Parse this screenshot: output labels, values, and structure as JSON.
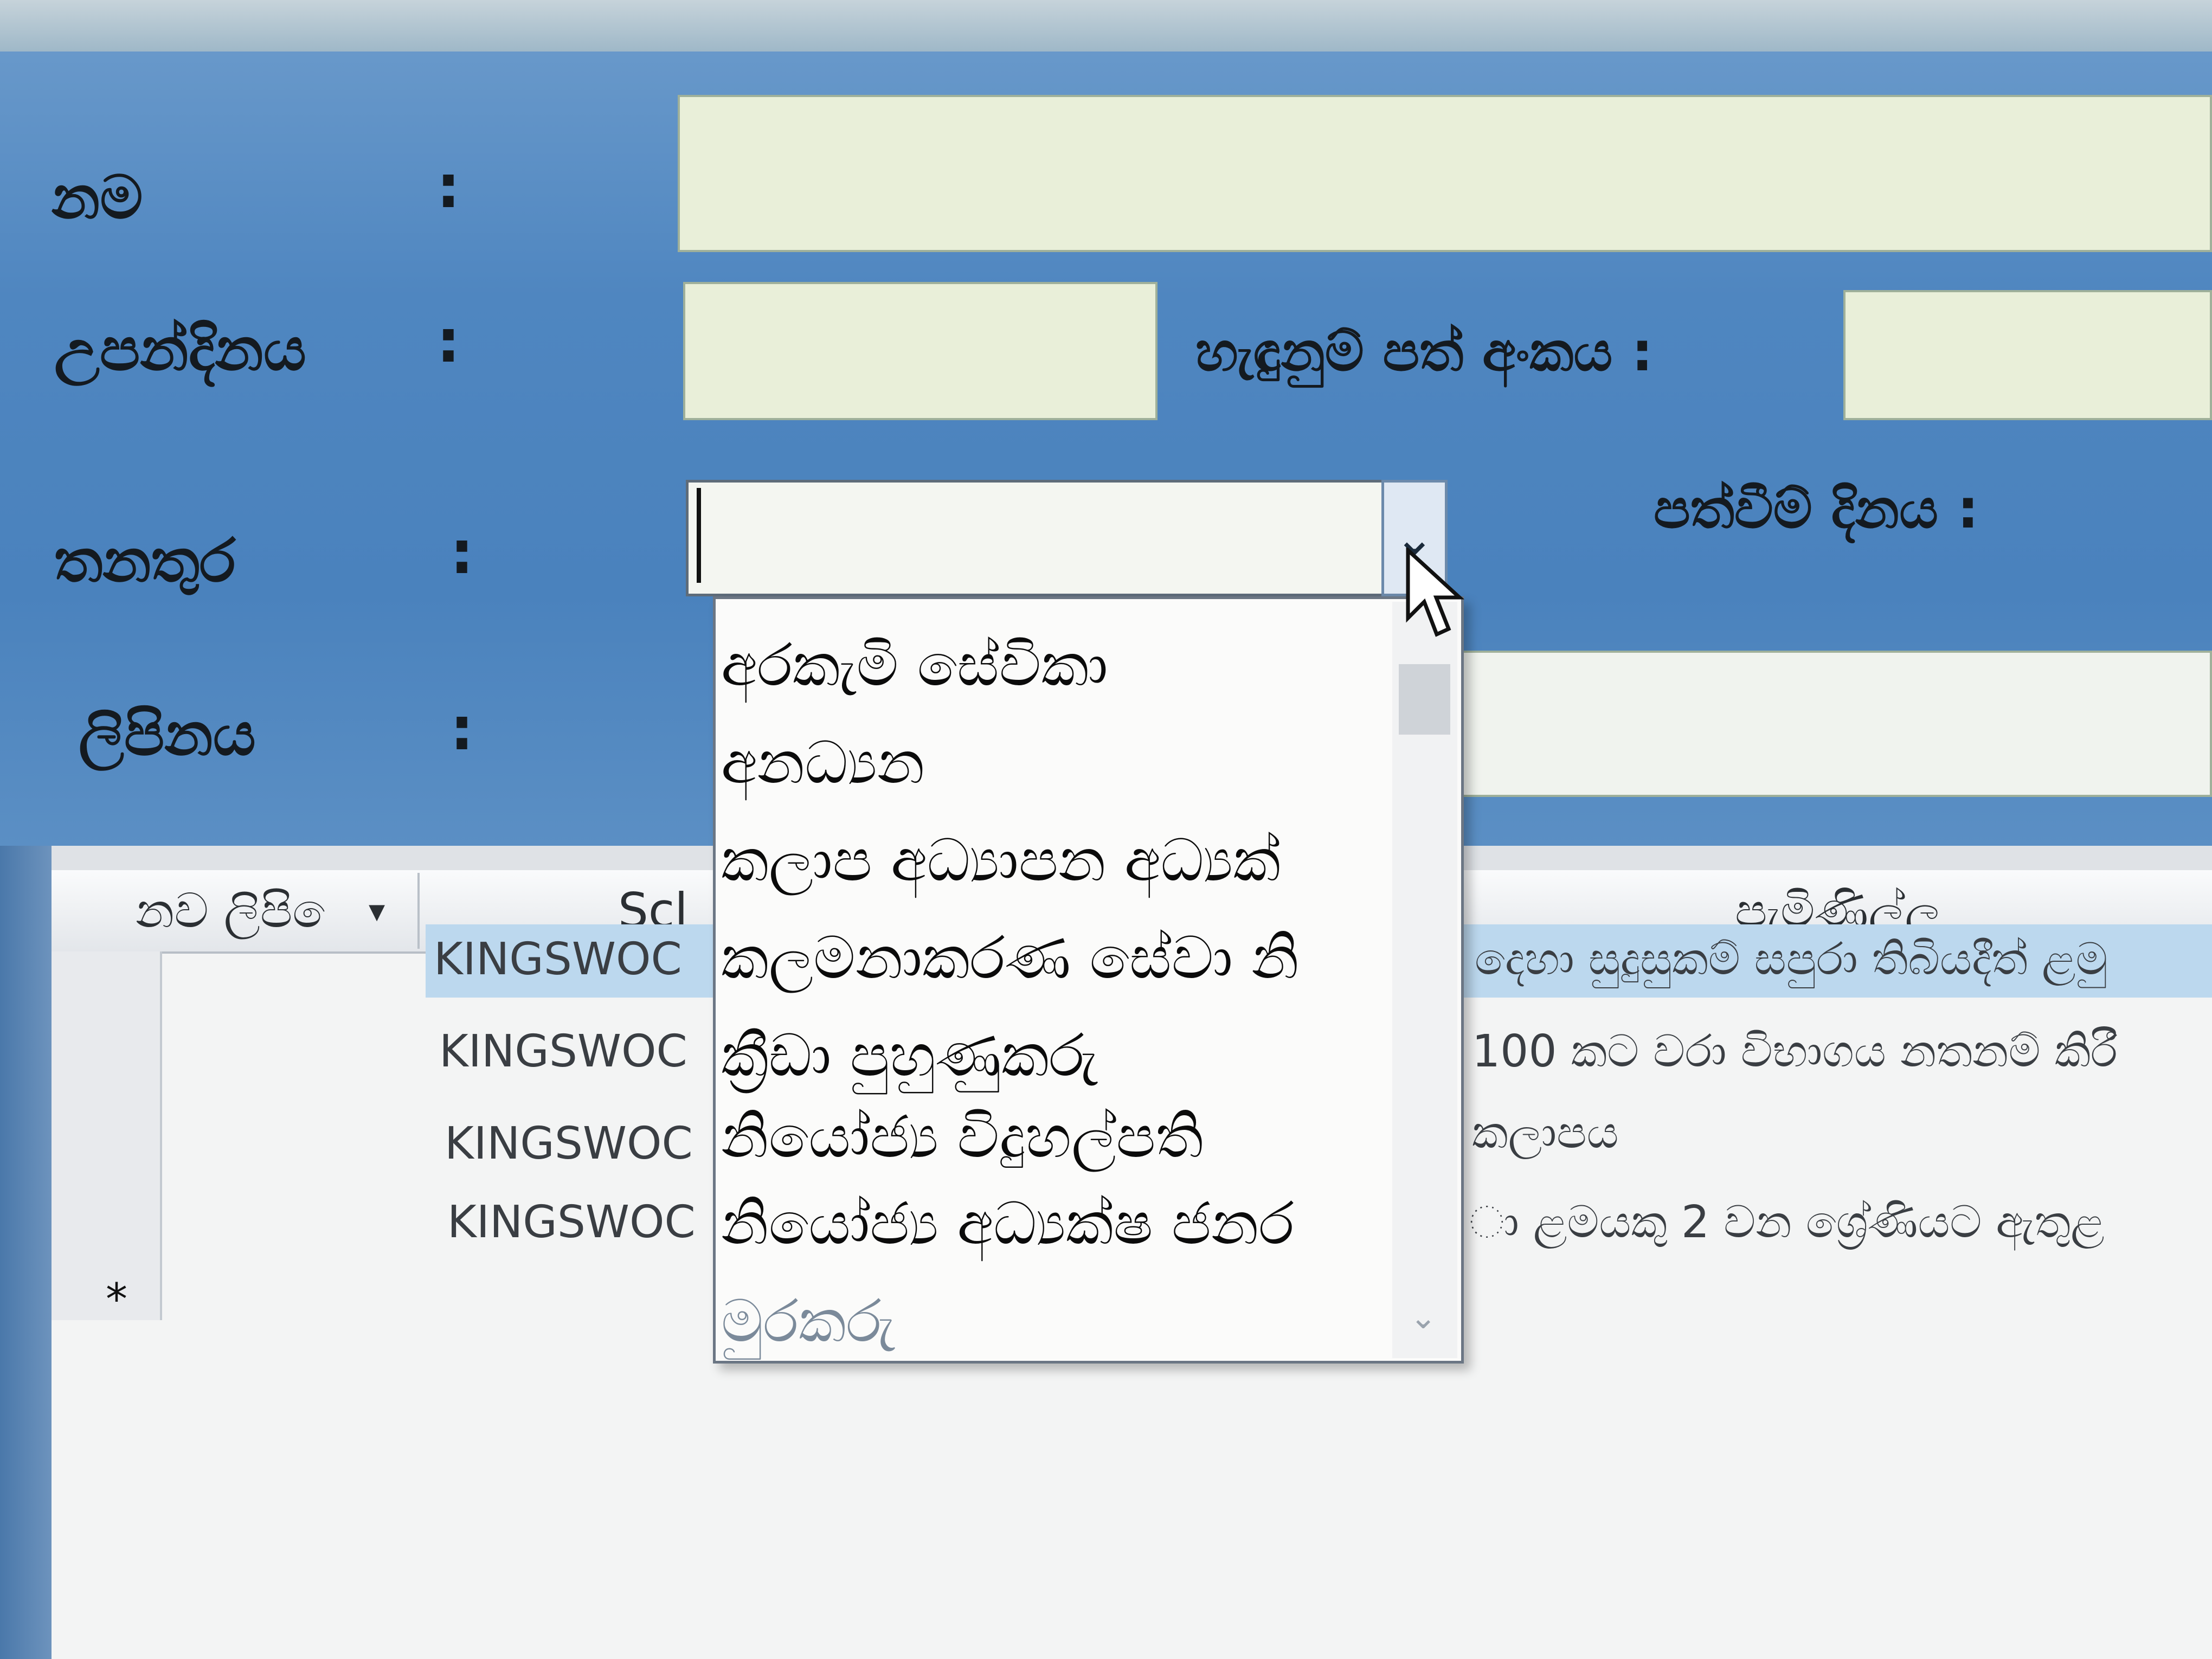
{
  "form": {
    "name_label": "නම",
    "dob_label": "උපන්දිනය",
    "nic_label": "හැඳුනුම් පත් අංකය :",
    "position_label": "තනතුර",
    "appointment_date_label": "පත්වීම් දිනය :",
    "address_label": "ලිපිනය",
    "colon": ":"
  },
  "dropdown": {
    "options": [
      "අරකැමි සේවිකා",
      "අනධ්‍යන",
      "කලාප අධ්‍යාපන අධ්‍යක්",
      "කලමනාකරණ සේවා නි",
      "ක්‍රීඩා පුහුණුකරු",
      "නියෝජ්‍ය විදුහල්පති",
      "නියෝජ්‍ය අධ්‍යක්ෂ ජනර",
      "මුරකරු"
    ]
  },
  "grid": {
    "headers": [
      "නව ලිපි ෙ",
      "Scl",
      "පැමිණිල්ල"
    ],
    "rows": [
      {
        "school": "KINGSWOC",
        "complaint": "දෙහා සුදුසුකම් සපුරා තිබියදීත් ළමු"
      },
      {
        "school": "KINGSWOC",
        "complaint": "100 කට වරා විභාගය නතනම් කිරී"
      },
      {
        "school": "KINGSWOC",
        "complaint": "කලාපය"
      },
      {
        "school": "KINGSWOC",
        "complaint": "ා ළමයකු 2 වන ශ්‍රේණියට ඇතුළ"
      }
    ],
    "new_row_marker": "*"
  },
  "colors": {
    "form_bg": "#4f86c0",
    "field_bg": "#e9efd9",
    "selected_row": "#bcd8ee"
  }
}
